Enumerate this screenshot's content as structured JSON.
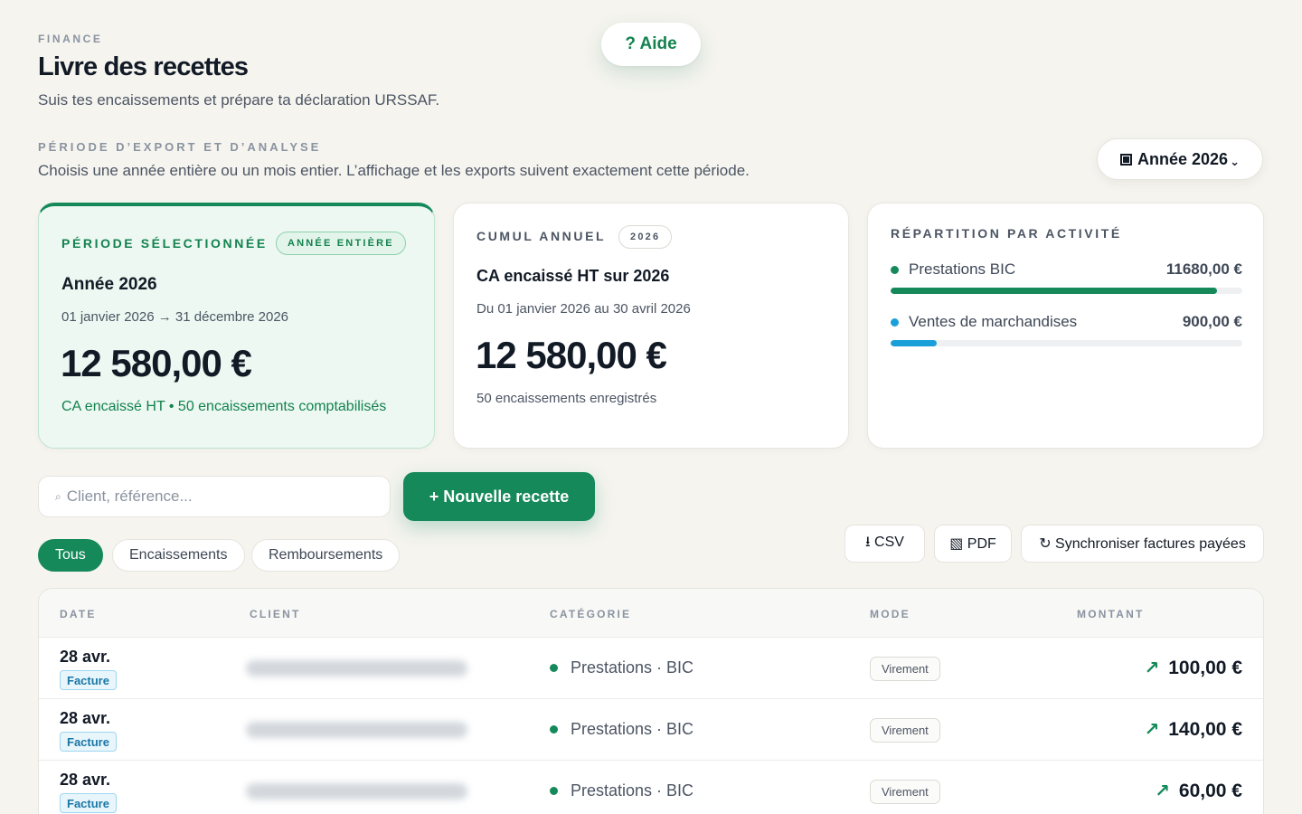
{
  "header": {
    "eyebrow": "FINANCE",
    "title": "Livre des recettes",
    "subtitle": "Suis tes encaissements et prépare ta déclaration URSSAF.",
    "help_label": "? Aide"
  },
  "period": {
    "eyebrow": "PÉRIODE D’EXPORT ET D’ANALYSE",
    "description": "Choisis une année entière ou un mois entier. L’affichage et les exports suivent exactement cette période.",
    "selector_label": "Année 2026",
    "selector_icon": "calendar-icon"
  },
  "selected_card": {
    "eyebrow": "PÉRIODE SÉLECTIONNÉE",
    "pill": "ANNÉE ENTIÈRE",
    "name": "Année 2026",
    "range": "01 janvier 2026 → 31 décembre 2026",
    "amount": "12 580,00 €",
    "note": "CA encaissé HT • 50 encaissements comptabilisés"
  },
  "cumul_card": {
    "eyebrow": "CUMUL ANNUEL",
    "pill": "2026",
    "name": "CA encaissé HT sur 2026",
    "range": "Du 01 janvier 2026 au 30 avril 2026",
    "amount": "12 580,00 €",
    "note": "50 encaissements enregistrés"
  },
  "repartition_card": {
    "eyebrow": "RÉPARTITION PAR ACTIVITÉ",
    "items": [
      {
        "label": "Prestations BIC",
        "value": "11680,00 €",
        "share": 0.9285,
        "color": "#15895a"
      },
      {
        "label": "Ventes de marchandises",
        "value": "900,00 €",
        "share": 0.13,
        "color": "#1b9fd8"
      }
    ]
  },
  "toolbar": {
    "search_placeholder": "Client, référence...",
    "new_label": "+ Nouvelle recette",
    "tabs": [
      {
        "label": "Tous",
        "active": true
      },
      {
        "label": "Encaissements",
        "active": false
      },
      {
        "label": "Remboursements",
        "active": false
      }
    ],
    "csv_label": "⭳ CSV",
    "pdf_label": "▧ PDF",
    "sync_label": "↻ Synchroniser factures payées"
  },
  "table": {
    "columns": [
      "DATE",
      "CLIENT",
      "CATÉGORIE",
      "MODE",
      "MONTANT"
    ],
    "rows": [
      {
        "date": "28 avr.",
        "badge": "Facture",
        "category": "Prestations · BIC",
        "mode": "Virement",
        "amount": "100,00 €"
      },
      {
        "date": "28 avr.",
        "badge": "Facture",
        "category": "Prestations · BIC",
        "mode": "Virement",
        "amount": "140,00 €"
      },
      {
        "date": "28 avr.",
        "badge": "Facture",
        "category": "Prestations · BIC",
        "mode": "Virement",
        "amount": "60,00 €"
      }
    ]
  },
  "colors": {
    "accent": "#15895a",
    "secondary": "#1b9fd8",
    "background": "#f5f4ef"
  }
}
